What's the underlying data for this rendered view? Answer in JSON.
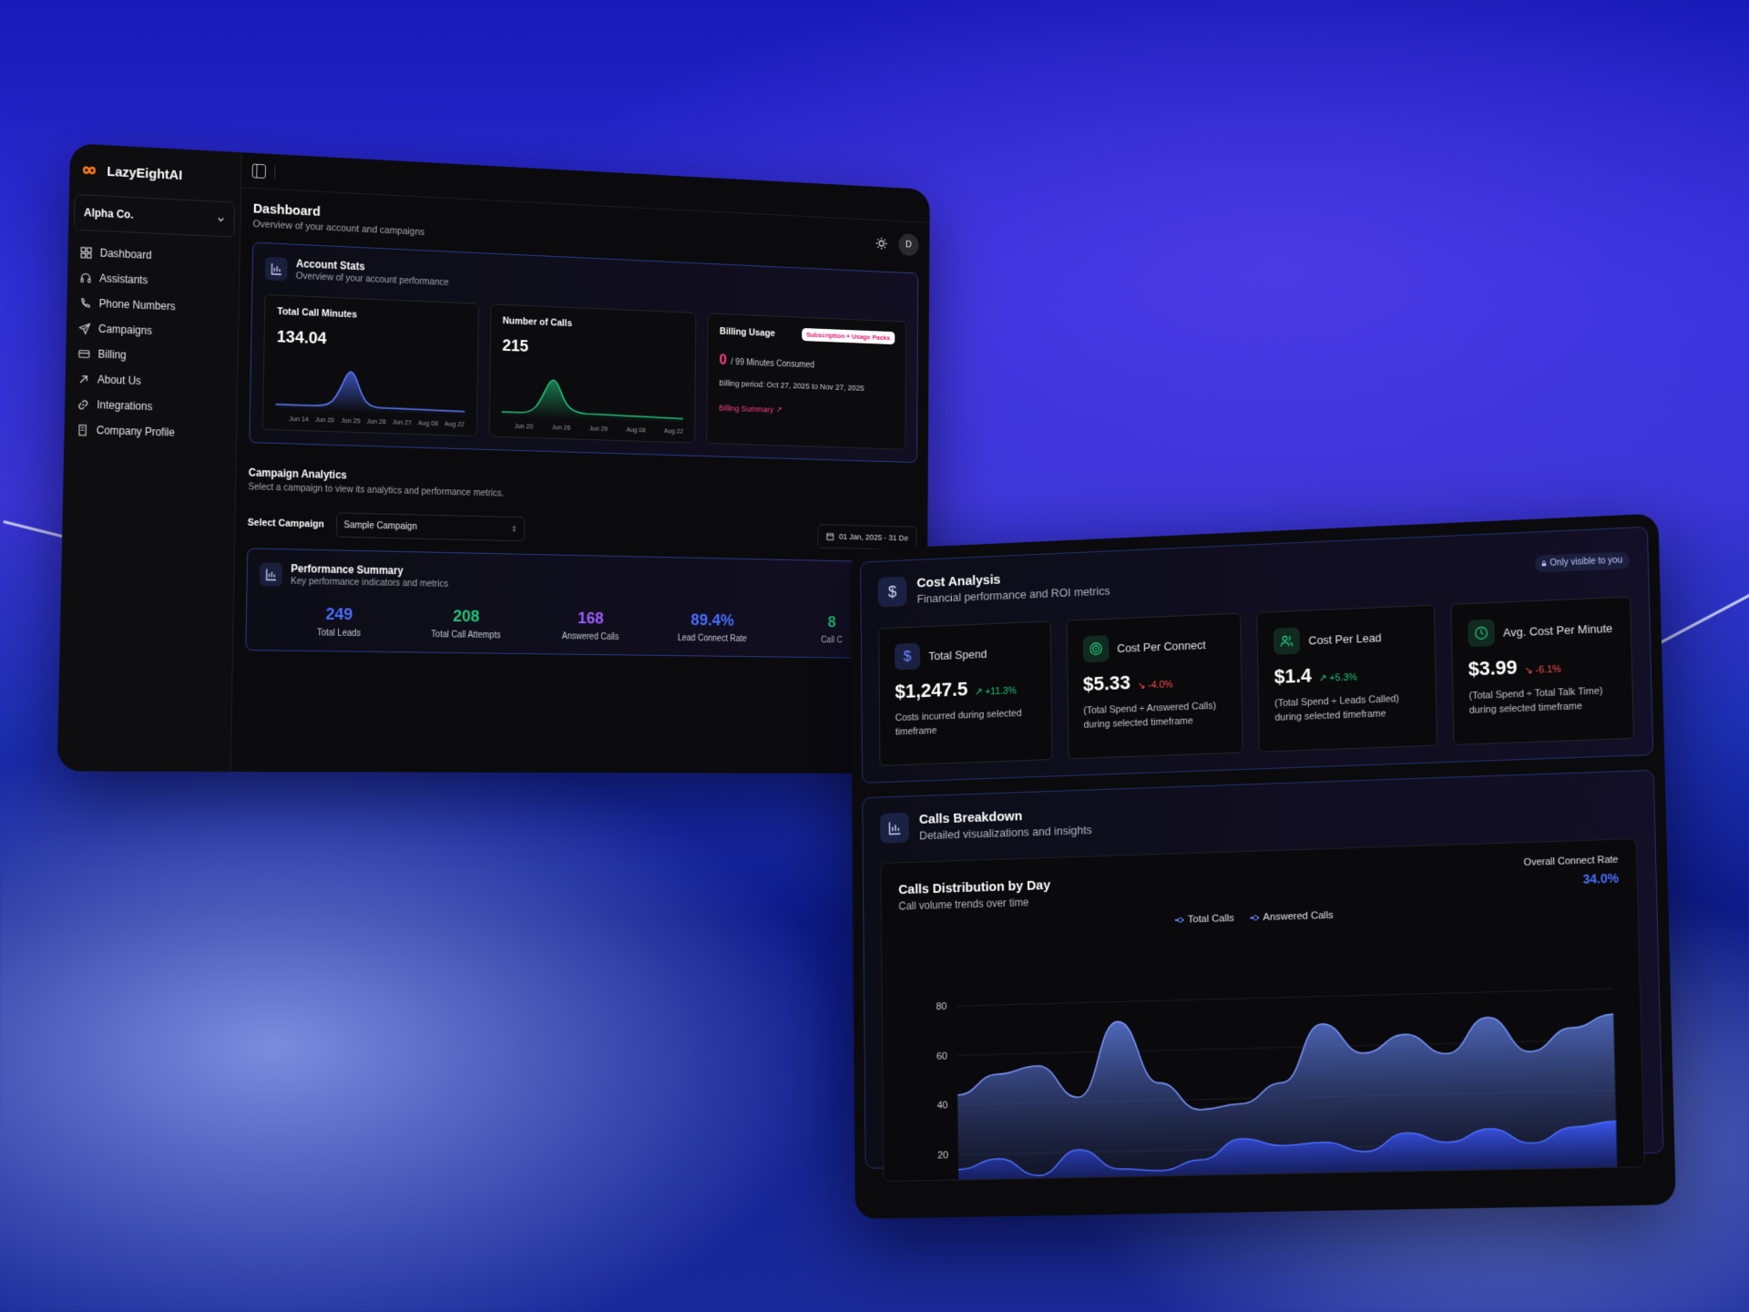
{
  "app": {
    "name": "LazyEightAI",
    "org": "Alpha Co."
  },
  "sidebar": {
    "items": [
      {
        "label": "Dashboard",
        "icon": "grid-icon"
      },
      {
        "label": "Assistants",
        "icon": "headset-icon"
      },
      {
        "label": "Phone Numbers",
        "icon": "phone-icon"
      },
      {
        "label": "Campaigns",
        "icon": "send-icon"
      },
      {
        "label": "Billing",
        "icon": "card-icon"
      },
      {
        "label": "About Us",
        "icon": "arrow-up-right-icon"
      },
      {
        "label": "Integrations",
        "icon": "link-icon"
      },
      {
        "label": "Company Profile",
        "icon": "building-icon"
      }
    ]
  },
  "dashboard": {
    "title": "Dashboard",
    "subtitle": "Overview of your account and campaigns",
    "avatar": "D",
    "account_stats": {
      "title": "Account Stats",
      "subtitle": "Overview of your account performance",
      "minutes": {
        "label": "Total Call Minutes",
        "value": "134.04",
        "ticks": [
          "Jun 14",
          "Jun 20",
          "Jun 25",
          "Jun 26",
          "Jun 27",
          "Aug 08",
          "Aug 22"
        ]
      },
      "calls": {
        "label": "Number of Calls",
        "value": "215",
        "ticks": [
          "Jun 20",
          "Jun 26",
          "Jun 29",
          "Aug 08",
          "Aug 22"
        ]
      },
      "billing": {
        "label": "Billing Usage",
        "badge": "Subscription + Usage Packs",
        "used": "0",
        "used_suffix": "/ 99 Minutes Consumed",
        "period": "Billing period: Oct 27, 2025 to Nov 27, 2025",
        "link": "Billing Summary"
      }
    },
    "campaign": {
      "title": "Campaign Analytics",
      "subtitle": "Select a campaign to view its analytics and performance metrics.",
      "select_label": "Select Campaign",
      "selected": "Sample Campaign",
      "date_range": "01 Jan, 2025 - 31 De"
    },
    "performance": {
      "title": "Performance Summary",
      "subtitle": "Key performance indicators and metrics",
      "metrics": [
        {
          "value": "249",
          "label": "Total Leads",
          "color": "#4b6dff"
        },
        {
          "value": "208",
          "label": "Total Call Attempts",
          "color": "#22c47a"
        },
        {
          "value": "168",
          "label": "Answered Calls",
          "color": "#9b5cff"
        },
        {
          "value": "89.4%",
          "label": "Lead Connect Rate",
          "color": "#4b6dff"
        },
        {
          "value": "8",
          "label": "Call C",
          "color": "#22c47a"
        }
      ]
    }
  },
  "cost": {
    "title": "Cost Analysis",
    "subtitle": "Financial performance and ROI metrics",
    "badge": "Only visible to you",
    "cards": [
      {
        "label": "Total Spend",
        "value": "$1,247.5",
        "delta": "+11.3%",
        "trend": "up",
        "desc": "Costs incurred during selected timeframe",
        "icon": "dollar-icon",
        "accent": "#4b6dff"
      },
      {
        "label": "Cost Per Connect",
        "value": "$5.33",
        "delta": "-4.0%",
        "trend": "down",
        "desc": "(Total Spend ÷ Answered Calls) during selected timeframe",
        "icon": "target-icon",
        "accent": "#22c47a"
      },
      {
        "label": "Cost Per Lead",
        "value": "$1.4",
        "delta": "+5.3%",
        "trend": "up",
        "desc": "(Total Spend ÷ Leads Called) during selected timeframe",
        "icon": "users-icon",
        "accent": "#22c47a"
      },
      {
        "label": "Avg. Cost Per Minute",
        "value": "$3.99",
        "delta": "-6.1%",
        "trend": "down",
        "desc": "(Total Spend ÷ Total Talk Time) during selected timeframe",
        "icon": "clock-icon",
        "accent": "#22c47a"
      }
    ]
  },
  "breakdown": {
    "title": "Calls Breakdown",
    "subtitle": "Detailed visualizations and insights",
    "chart_title": "Calls Distribution by Day",
    "chart_sub": "Call volume trends over time",
    "rate_label": "Overall Connect Rate",
    "rate_value": "34.0%",
    "legend": [
      "Total Calls",
      "Answered Calls"
    ]
  },
  "chart_data": {
    "type": "area",
    "title": "Calls Distribution by Day",
    "ylim": [
      10,
      85
    ],
    "yticks": [
      20,
      40,
      60,
      80
    ],
    "series": [
      {
        "name": "Total Calls",
        "values": [
          44,
          52,
          55,
          42,
          72,
          47,
          36,
          38,
          46,
          69,
          57,
          64,
          56,
          70,
          56,
          65,
          70
        ]
      },
      {
        "name": "Answered Calls",
        "values": [
          14,
          18,
          11,
          21,
          13,
          12,
          16,
          24,
          21,
          22,
          18,
          25,
          21,
          26,
          20,
          26,
          28
        ]
      }
    ]
  },
  "colors": {
    "accent": "#4b6dff",
    "positive": "#22c47a",
    "negative": "#ff4b4b",
    "pink": "#ff3d8b"
  }
}
